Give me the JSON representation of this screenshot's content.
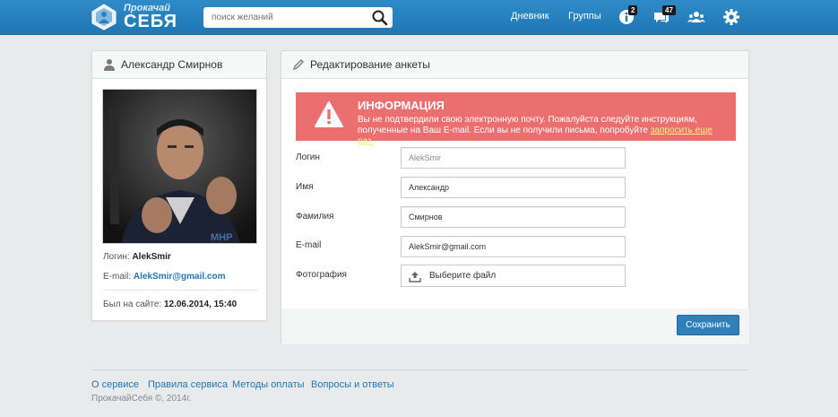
{
  "header": {
    "logo": {
      "small": "Прокачай",
      "big": "СЕБЯ"
    },
    "search": {
      "placeholder": "поиск желаний"
    },
    "nav": {
      "diary": "Дневник",
      "groups": "Группы"
    },
    "badges": {
      "notifications": "2",
      "messages": "47"
    },
    "icons": [
      "search-icon",
      "info-icon",
      "messages-icon",
      "people-icon",
      "gear-icon"
    ]
  },
  "profile": {
    "name": "Александр Смирнов",
    "login_label": "Логин:",
    "login": "AlekSmir",
    "email_label": "E-mail:",
    "email": "AlekSmir@gmail.com",
    "last_seen_label": "Был на сайте:",
    "last_seen": "12.06.2014, 15:40"
  },
  "edit": {
    "title": "Редактирование анкеты",
    "alert": {
      "title": "ИНФОРМАЦИЯ",
      "message": "Вы не подтвердили свою электронную почту. Пожалуйста следуйте инструкциям, полученные на Ваш E-mail. Если вы не получили письма, попробуйте ",
      "link": "запросить еще раз."
    },
    "fields": [
      {
        "label": "Логин",
        "value": "AlekSmir"
      },
      {
        "label": "Имя",
        "value": "Александр"
      },
      {
        "label": "Фамилия",
        "value": "Смирнов"
      },
      {
        "label": "E-mail",
        "value": "AlekSmir@gmail.com"
      },
      {
        "label": "Фотография",
        "value": "Выберите файл"
      }
    ],
    "save_label": "Сохранить"
  },
  "footer": {
    "links": [
      "О сервисе",
      "Правила сервиса",
      "Методы оплаты",
      "Вопросы и ответы"
    ],
    "copyright": "ПрокачайСебя ©, 2014г."
  },
  "colors": {
    "header": "#1f77b4",
    "alert": "#ec6f70",
    "link": "#1f77b4",
    "button": "#2f7fba"
  }
}
